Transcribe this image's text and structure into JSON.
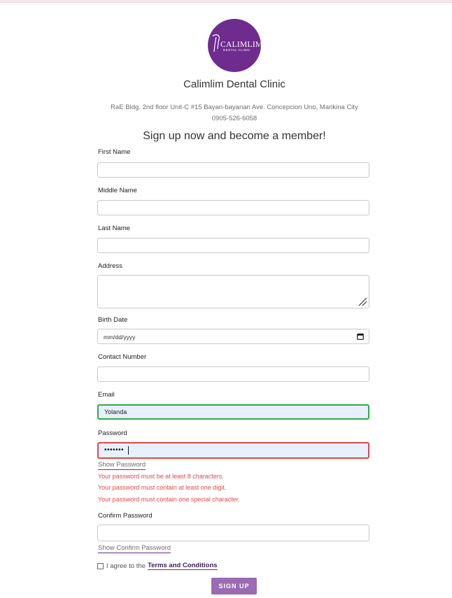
{
  "brand": {
    "logo_main": "CALIMLIM",
    "logo_sub": "DENTAL CLINIC",
    "clinic_name": "Calimlim Dental Clinic",
    "address": "RaE Bldg. 2nd floor Unit-C #15 Bayan-bayanan Ave. Concepcion Uno, Marikina City",
    "phone": "0905-526-6058",
    "accent_color": "#6f2c8f"
  },
  "form": {
    "title": "Sign up now and become a member!",
    "first_name": {
      "label": "First Name",
      "value": ""
    },
    "middle_name": {
      "label": "Middle Name",
      "value": ""
    },
    "last_name": {
      "label": "Last Name",
      "value": ""
    },
    "address": {
      "label": "Address",
      "value": ""
    },
    "birth_date": {
      "label": "Birth Date",
      "placeholder": "mm/dd/yyyy"
    },
    "contact_number": {
      "label": "Contact Number",
      "value": ""
    },
    "email": {
      "label": "Email",
      "value": "Yolanda",
      "status": "valid"
    },
    "password": {
      "label": "Password",
      "masked_value": "•••••••",
      "status": "invalid",
      "show_label": "Show Password",
      "errors": [
        "Your password must be at least 8 characters.",
        "Your password must contain at least one digit.",
        "Your password must contain one special character."
      ]
    },
    "confirm_password": {
      "label": "Confirm Password",
      "value": "",
      "show_label": "Show Confirm Password"
    },
    "agree": {
      "text": "I agree to the",
      "link": "Terms and Conditions",
      "checked": false
    },
    "submit_label": "SIGN UP"
  }
}
